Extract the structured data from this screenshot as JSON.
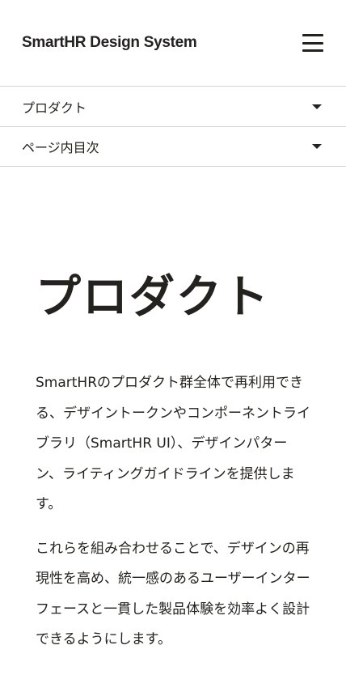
{
  "header": {
    "logo_text": "SmartHR Design System",
    "menu_icon": "hamburger-menu-icon"
  },
  "nav": {
    "product_label": "プロダクト",
    "toc_label": "ページ内目次",
    "caret_icon": "caret-down-icon"
  },
  "main": {
    "title": "プロダクト",
    "paragraph1": "SmartHRのプロダクト群全体で再利用できる、デザイントークンやコンポーネントライブラリ（SmartHR UI）、デザインパターン、ライティングガイドラインを提供します。",
    "paragraph2": "これらを組み合わせることで、デザインの再現性を高め、統一感のあるユーザーインターフェースと一貫した製品体験を効率よく設計できるようにします。"
  }
}
